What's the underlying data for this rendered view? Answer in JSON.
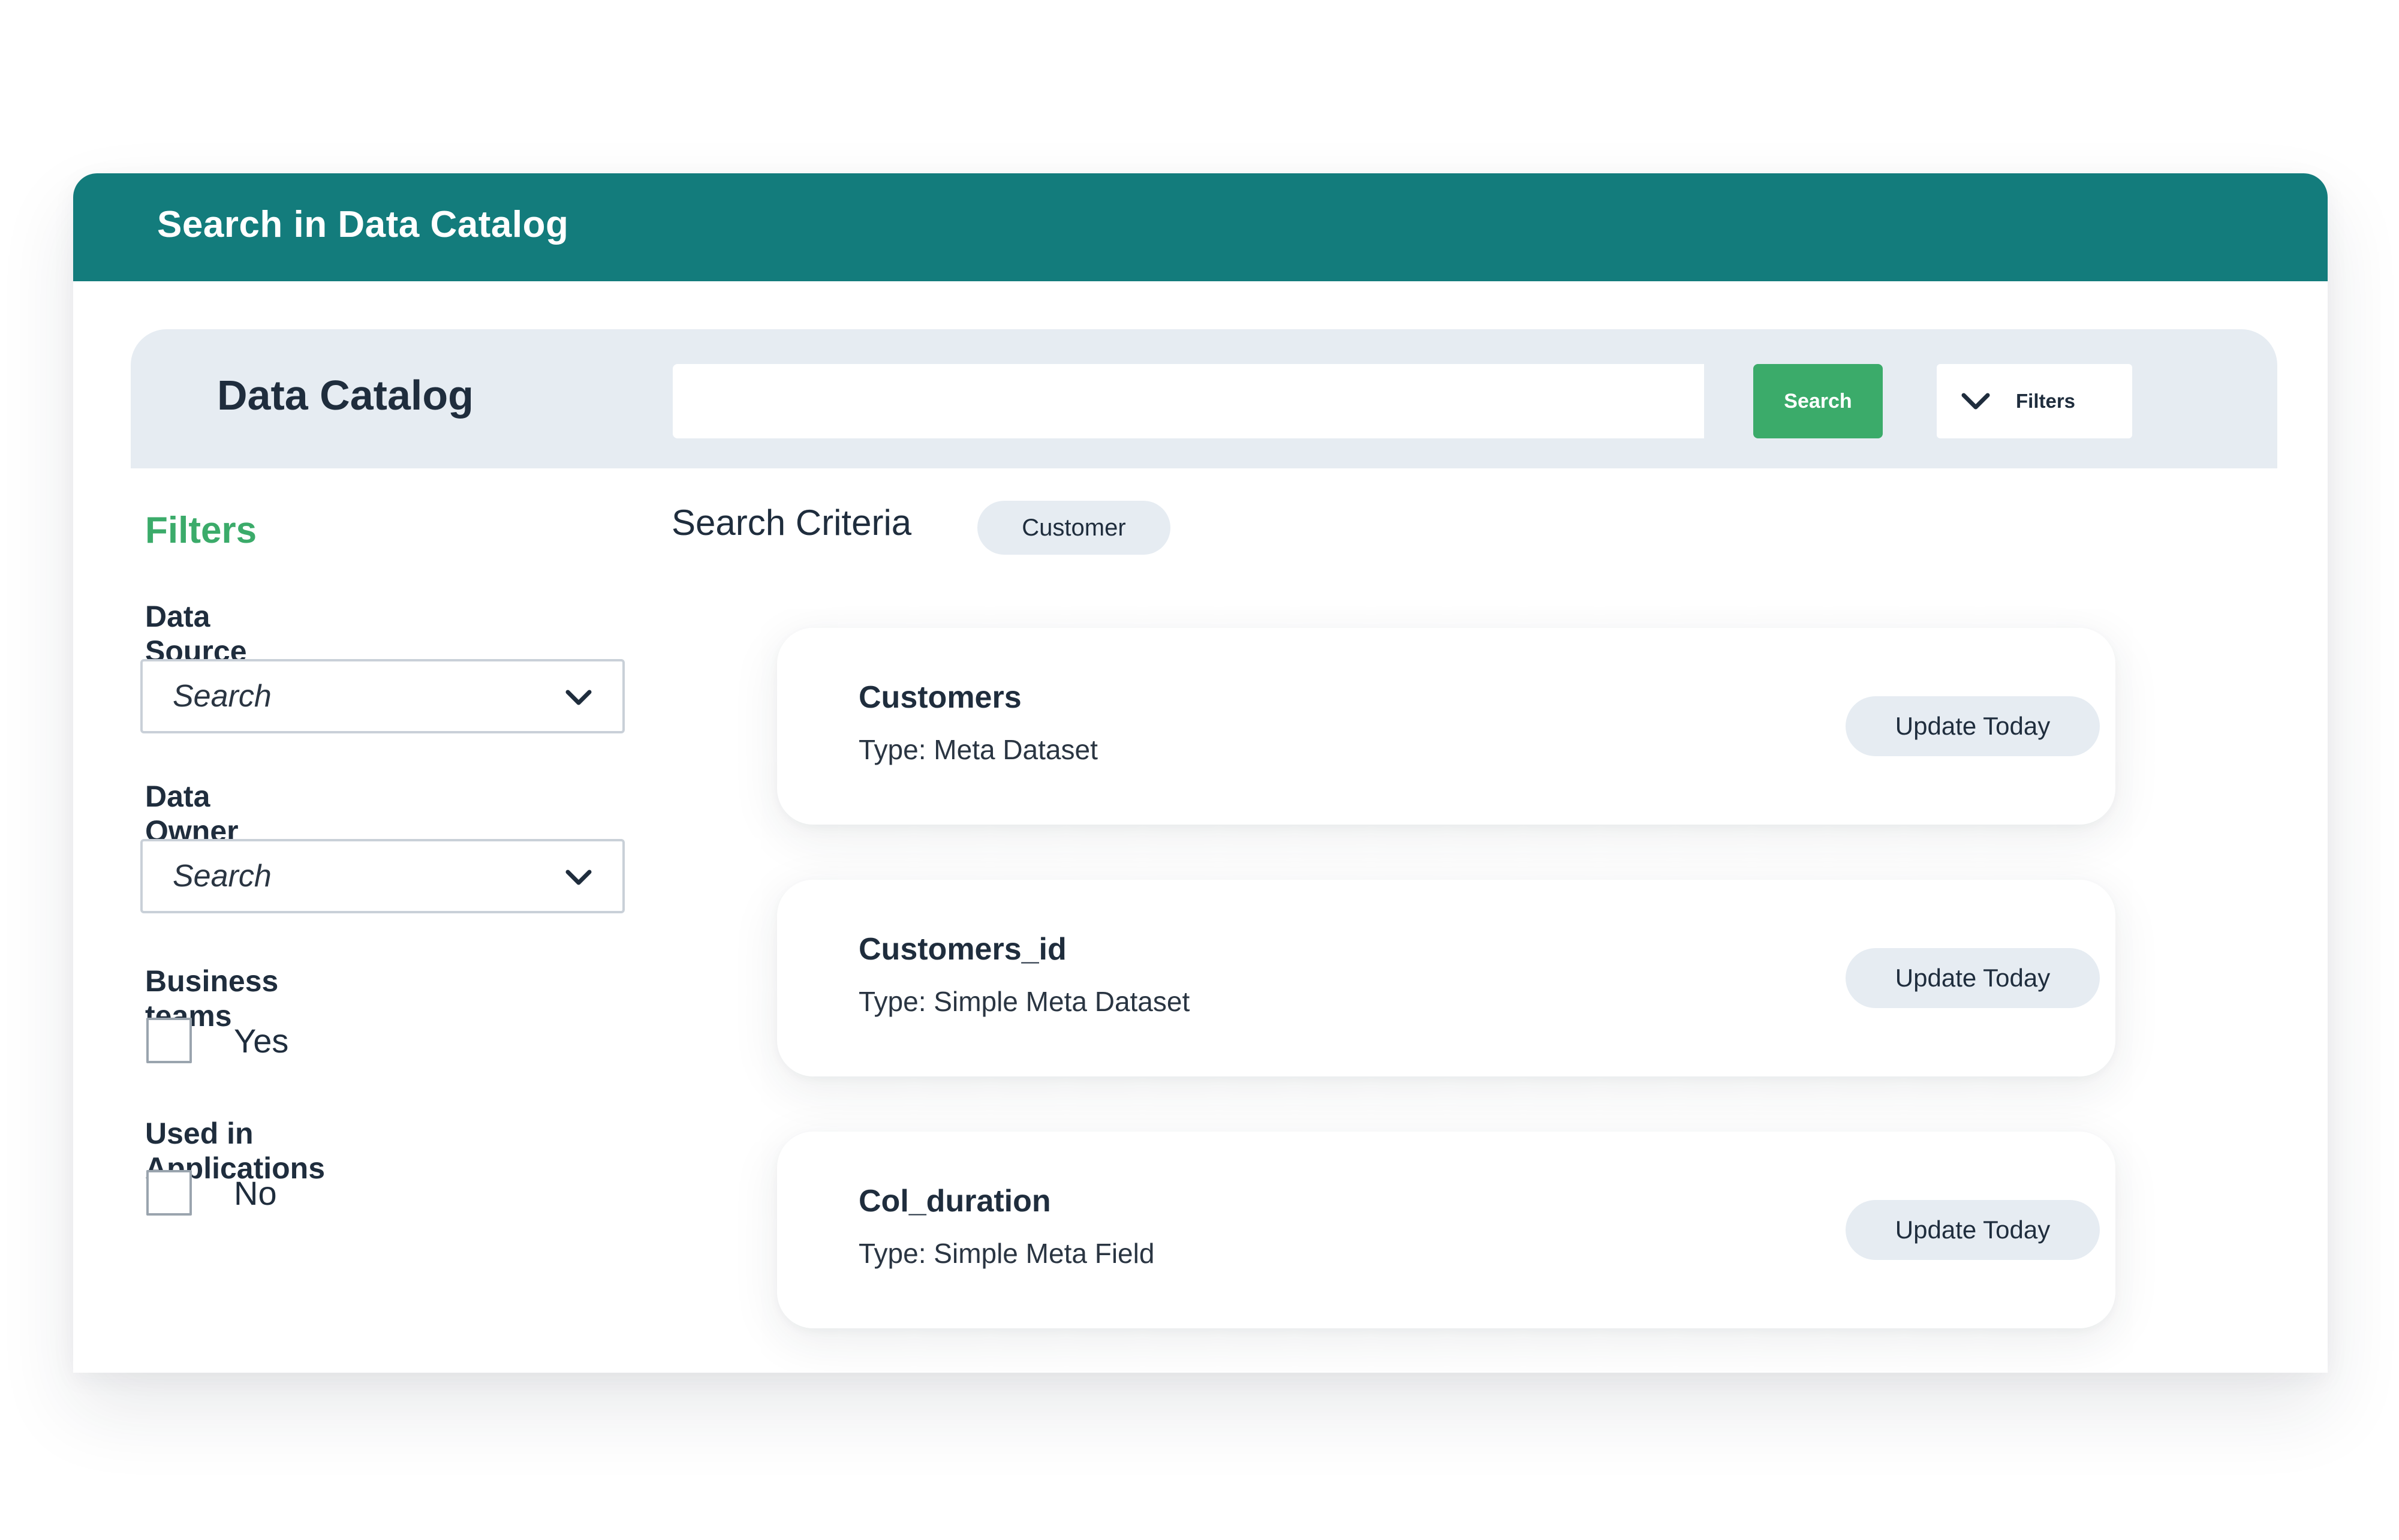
{
  "window": {
    "title": "Search in Data Catalog"
  },
  "topbar": {
    "title": "Data Catalog",
    "search_value": "",
    "search_button": "Search",
    "filters_toggle": "Filters"
  },
  "sidebar": {
    "heading": "Filters",
    "data_source": {
      "label": "Data Source",
      "placeholder": "Search"
    },
    "data_owner": {
      "label": "Data Owner",
      "placeholder": "Search"
    },
    "business_teams": {
      "label": "Business teams",
      "option": "Yes",
      "checked": false
    },
    "used_in_apps": {
      "label": "Used in Applications",
      "option": "No",
      "checked": false
    }
  },
  "criteria": {
    "label": "Search Criteria",
    "chip": "Customer"
  },
  "results": [
    {
      "title": "Customers",
      "type": "Type: Meta Dataset",
      "badge": "Update Today"
    },
    {
      "title": "Customers_id",
      "type": "Type: Simple Meta Dataset",
      "badge": "Update Today"
    },
    {
      "title": "Col_duration",
      "type": "Type: Simple Meta Field",
      "badge": "Update Today"
    }
  ],
  "colors": {
    "titlebar": "#137c7c",
    "accent_green": "#3bab6a",
    "panel_bg": "#e6ecf2",
    "text": "#1f2d3d"
  }
}
